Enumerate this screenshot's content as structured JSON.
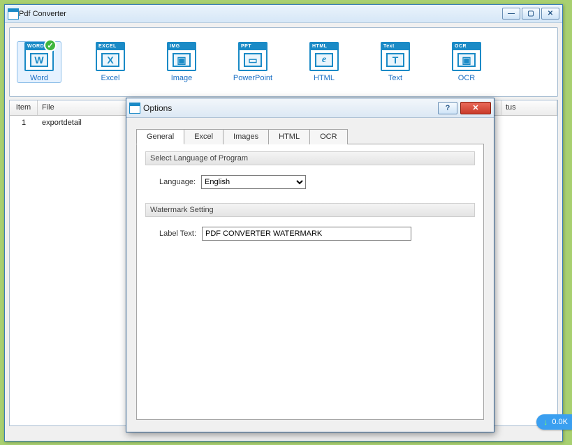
{
  "window": {
    "title": "Pdf Converter"
  },
  "formats": [
    {
      "label": "Word",
      "tag": "WORD",
      "glyph": "W",
      "active": true
    },
    {
      "label": "Excel",
      "tag": "EXCEL",
      "glyph": "X"
    },
    {
      "label": "Image",
      "tag": "IMG",
      "glyph": "▣"
    },
    {
      "label": "PowerPoint",
      "tag": "PPT",
      "glyph": "▭"
    },
    {
      "label": "HTML",
      "tag": "HTML",
      "glyph": "e"
    },
    {
      "label": "Text",
      "tag": "Text",
      "glyph": "T"
    },
    {
      "label": "OCR",
      "tag": "OCR",
      "glyph": "▣"
    }
  ],
  "table": {
    "headers": {
      "item": "Item",
      "file": "File",
      "status": "tus"
    },
    "rows": [
      {
        "item": "1",
        "file": "exportdetail"
      }
    ]
  },
  "options": {
    "title": "Options",
    "tabs": [
      "General",
      "Excel",
      "Images",
      "HTML",
      "OCR"
    ],
    "activeTab": 0,
    "sections": {
      "lang_head": "Select Language of Program",
      "lang_label": "Language:",
      "lang_value": "English",
      "wm_head": "Watermark Setting",
      "wm_label": "Label Text:",
      "wm_value": "PDF CONVERTER WATERMARK"
    }
  },
  "badge": {
    "text": "0.0K"
  }
}
